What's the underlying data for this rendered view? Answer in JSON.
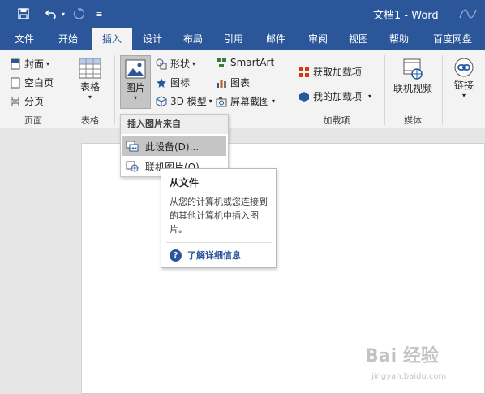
{
  "app": {
    "title": "文档1  -  Word",
    "brand_color": "#2b579a"
  },
  "qat": {
    "save_icon": "save-icon",
    "undo_icon": "undo-icon",
    "redo_icon": "redo-icon",
    "customize_icon": "customize-icon"
  },
  "tabs": [
    {
      "label": "文件"
    },
    {
      "label": "开始"
    },
    {
      "label": "插入"
    },
    {
      "label": "设计"
    },
    {
      "label": "布局"
    },
    {
      "label": "引用"
    },
    {
      "label": "邮件"
    },
    {
      "label": "审阅"
    },
    {
      "label": "视图"
    },
    {
      "label": "帮助"
    },
    {
      "label": "百度网盘"
    }
  ],
  "ribbon": {
    "pages_group": {
      "cover": "封面",
      "blank": "空白页",
      "break": "分页",
      "label": "页面"
    },
    "tables_group": {
      "table": "表格",
      "label": "表格"
    },
    "illustrations": {
      "pictures": "图片",
      "shapes": "形状",
      "icons": "图标",
      "model3d": "3D 模型",
      "smartart": "SmartArt",
      "chart": "图表",
      "screenshot": "屏幕截图"
    },
    "addins": {
      "get": "获取加载项",
      "my": "我的加载项",
      "label": "加载项"
    },
    "media": {
      "online_video": "联机视频",
      "label": "媒体"
    },
    "links": {
      "link": "链接"
    }
  },
  "dropdown": {
    "header": "插入图片来自",
    "this_device": "此设备(D)...",
    "online_pictures": "联机图片(O)..."
  },
  "tooltip": {
    "title": "从文件",
    "desc": "从您的计算机或您连接到的其他计算机中插入图片。",
    "help": "了解详细信息"
  },
  "watermark": {
    "main": "Bai 经验",
    "sub": "jingyan.baidu.com"
  }
}
